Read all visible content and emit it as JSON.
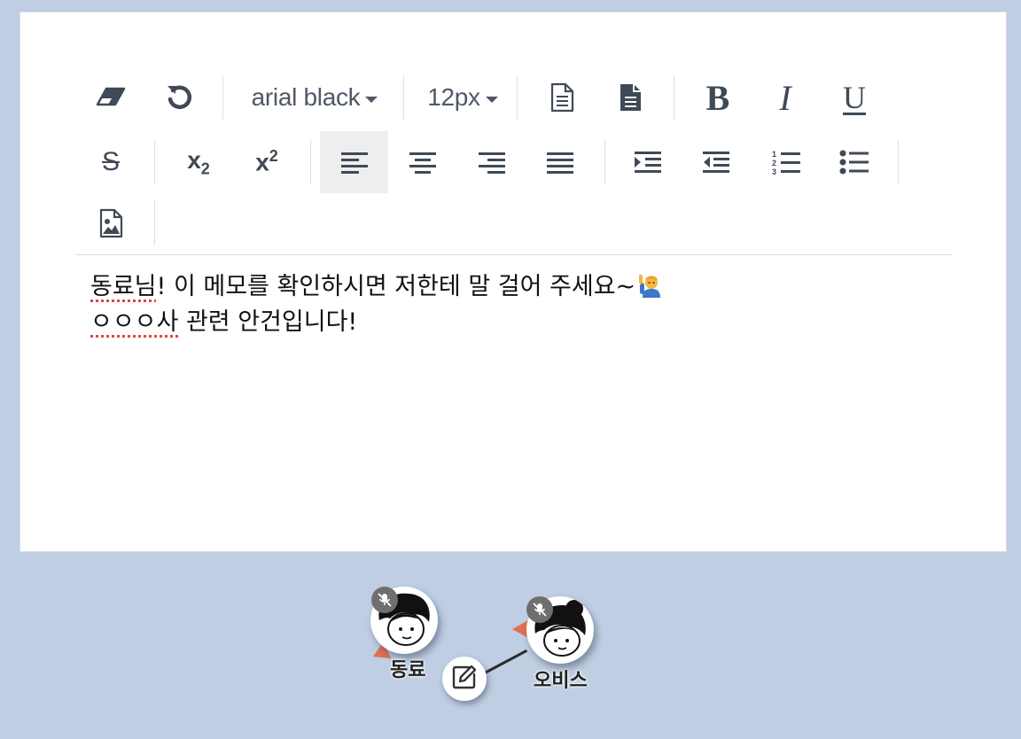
{
  "editor": {
    "font_family": "arial black",
    "font_size": "12px",
    "toolbar": {
      "bold": "B",
      "italic": "I",
      "underline": "U",
      "strikethrough": "S",
      "subscript_base": "x",
      "subscript_sub": "2",
      "superscript_base": "x",
      "superscript_sup": "2"
    },
    "content": {
      "line1_word": "동료님",
      "line1_rest": "! 이 메모를 확인하시면 저한테 말 걸어 주세요~",
      "line1_emoji": "raising-hand-emoji",
      "line2_word": "ㅇㅇㅇ사",
      "line2_rest": " 관련 안건입니다!"
    },
    "active_alignment": "align-left"
  },
  "participants": [
    {
      "name": "동료",
      "muted": true
    },
    {
      "name": "오비스",
      "muted": true
    }
  ],
  "colors": {
    "background": "#bfcee2",
    "panel": "#ffffff",
    "pointer": "#e07054",
    "spell_underline": "#e0473a",
    "icon": "#3f4a56"
  }
}
